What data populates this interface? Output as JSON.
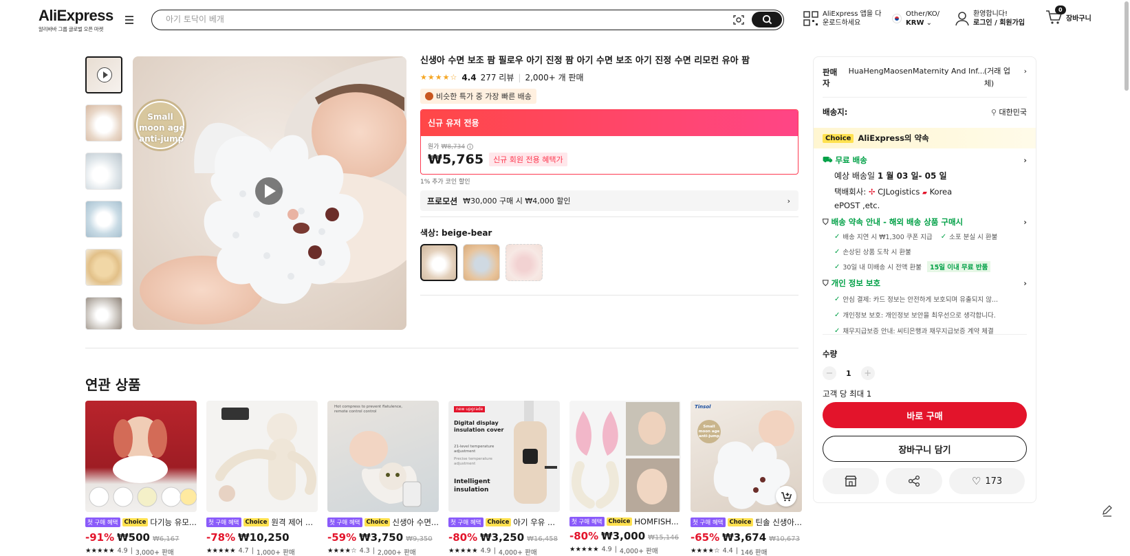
{
  "header": {
    "logo": "AliExpress",
    "logo_tagline": "알리바바 그룹 글로벌 오픈 마켓",
    "search_placeholder": "아기 토닥이 베개",
    "app_line1": "AliExpress 앱을 다",
    "app_line2": "운로드하세요",
    "region_line1": "Other/KO/",
    "region_line2": "KRW",
    "account_line1": "환영합니다!",
    "account_line2": "로그인 / 회원가입",
    "cart_count": "0",
    "cart_label": "장바구니"
  },
  "product": {
    "title": "신생아 수면 보조 팜 필로우 아기 진정 팜 아기 수면 보조 아기 진정 수면 리모컨 유아 팜",
    "rating": "4.4",
    "reviews": "277 리뷰",
    "sold": "2,000+ 개 판매",
    "fast_badge": "비슷한 특가 중 가장 빠른 배송",
    "deal_header": "신규 유저 전용",
    "orig_label": "원가",
    "orig_price": "₩8,734",
    "price": "₩5,765",
    "newbie_tag": "신규 회원 전용 혜택가",
    "coin_note": "1% 추가 코인 할인",
    "promo_label": "프로모션",
    "promo_text": "₩30,000 구매 시 ₩4,000 할인",
    "color_label": "색상: beige-bear",
    "image_badge": [
      "Small",
      "moon age",
      "anti-jump"
    ]
  },
  "panel": {
    "seller_label": "판매자",
    "seller_name": "HuaHengMaosenMaternity And Inf...",
    "seller_suffix": "(거래 업체)",
    "ship_label": "배송지:",
    "ship_to": "대한민국",
    "choice_tag": "Choice",
    "choice_text": "AliExpress의 약속",
    "free_ship": "무료 배송",
    "delivery_prefix": "예상 배송일",
    "delivery_date": "1 월 03 일- 05 일",
    "carrier_prefix": "택배회사:",
    "carrier_1": "CJLogistics",
    "carrier_2": "Korea",
    "carrier_3": "ePOST ,etc.",
    "promise_title": "배송 약속 안내 - 해외 배송 상품 구매시",
    "promise_1": "배송 지연 시 ₩1,300 쿠폰 지급",
    "promise_2": "소포 분실 시 환불",
    "promise_3": "손상된 상품 도착 시 환불",
    "promise_4": "30일 내 미배송 시 전액 환불",
    "promise_4_tag": "15일 이내 무료 반품",
    "privacy_title": "개인 정보 보호",
    "privacy_1": "안심 결제: 카드 정보는 안전하게 보호되며 유출되지 않...",
    "privacy_2": "개인정보 보호: 개인정보 보안을 최우선으로 생각합니다.",
    "privacy_3": "채무지급보증 안내: 씨티은행과 채무지급보증 계약 체결",
    "qty_label": "수량",
    "qty_value": "1",
    "qty_limit": "고객 당 최대 1",
    "buy_now": "바로 구매",
    "add_cart": "장바구니 담기",
    "wish_count": "173"
  },
  "related": {
    "title": "연관 상품",
    "first_tag": "첫 구매 혜택",
    "choice_tag": "Choice",
    "cards": [
      {
        "name": "다기능 유모...",
        "disc": "-91%",
        "price": "₩500",
        "strike": "₩6,167",
        "rating": "4.9",
        "sold": "3,000+ 판매"
      },
      {
        "name": "원격 제어 ...",
        "disc": "-78%",
        "price": "₩10,250",
        "strike": "",
        "rating": "4.7",
        "sold": "1,000+ 판매"
      },
      {
        "name": "신생아 수면...",
        "disc": "-59%",
        "price": "₩3,750",
        "strike": "₩9,350",
        "rating": "4.3",
        "sold": "2,000+ 판매"
      },
      {
        "name": "아기 우유 ...",
        "disc": "-80%",
        "price": "₩3,250",
        "strike": "₩16,458",
        "rating": "4.9",
        "sold": "4,000+ 판매"
      },
      {
        "name": "HOMFISH...",
        "disc": "-80%",
        "price": "₩3,000",
        "strike": "₩15,146",
        "rating": "4.9",
        "sold": "4,000+ 판매"
      },
      {
        "name": "틴솔 신생아...",
        "disc": "-65%",
        "price": "₩3,674",
        "strike": "₩10,673",
        "rating": "4.4",
        "sold": "146 판매"
      }
    ],
    "card_image_text": {
      "c3": "Hot compress to prevent flatulence, remote control control",
      "c4_new": "new upgrade",
      "c4_a": "Digital display insulation cover",
      "c4_b": "21-level temperature adjustment",
      "c4_c": "Precise temperature adjustment",
      "c4_d": "Intelligent insulation",
      "c6_brand": "Tinsol",
      "c6_badge": "Small moon age anti-jump"
    }
  },
  "colors": {
    "accent_red": "#e3142b",
    "deal_gradient_start": "#ff4747",
    "deal_gradient_end": "#ff4586",
    "choice_yellow": "#ffe14f",
    "green": "#00a046"
  }
}
